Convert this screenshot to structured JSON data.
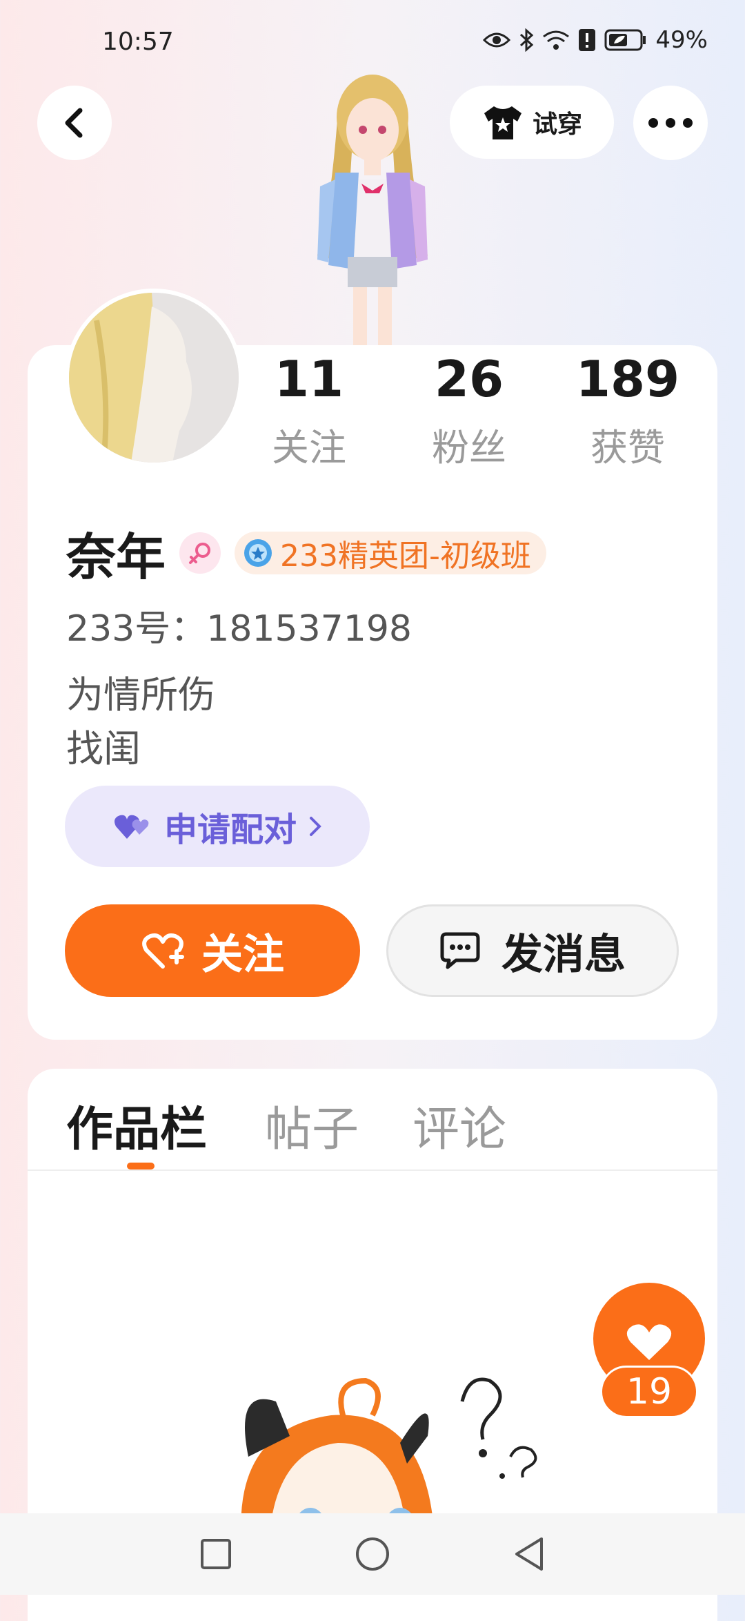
{
  "status_bar": {
    "time": "10:57",
    "battery": "49%"
  },
  "header": {
    "try_on_label": "试穿"
  },
  "stats": [
    {
      "value": "11",
      "label": "关注"
    },
    {
      "value": "26",
      "label": "粉丝"
    },
    {
      "value": "189",
      "label": "获赞"
    }
  ],
  "profile": {
    "name": "奈年",
    "rank_badge": "233精英团-初级班",
    "id_line": "233号：181537198",
    "bio_lines": [
      "为情所伤",
      "找闺"
    ],
    "pair_label": "申请配对"
  },
  "actions": {
    "follow_label": "关注",
    "message_label": "发消息"
  },
  "tabs": [
    "作品栏",
    "帖子",
    "评论"
  ],
  "like_bubble": {
    "count": "19"
  },
  "colors": {
    "accent": "#fb6e18",
    "pair_purple": "#6a5fd9",
    "rank_orange": "#f07324"
  }
}
